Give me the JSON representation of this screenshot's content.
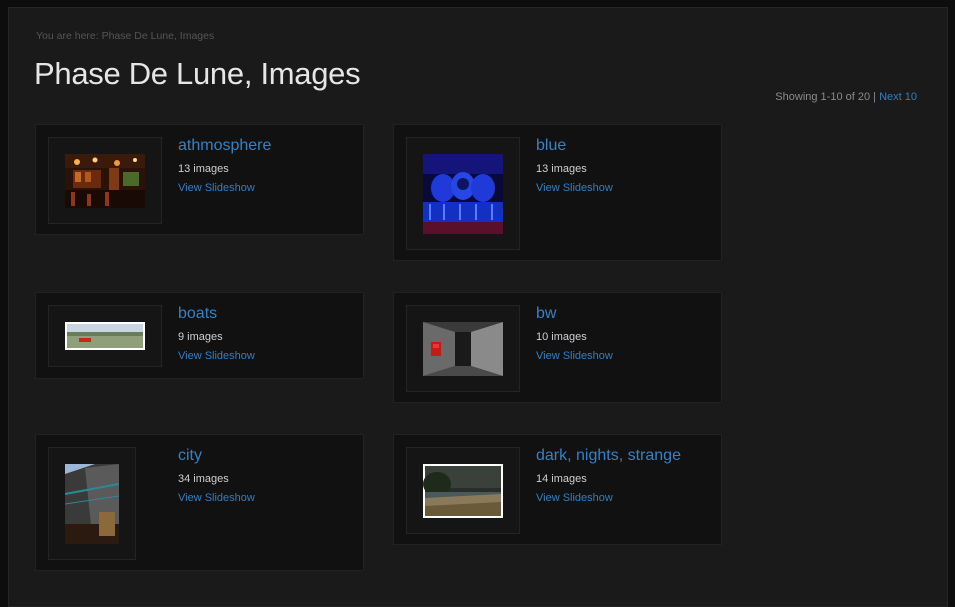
{
  "breadcrumb": "You are here: Phase De Lune, Images",
  "title": "Phase De Lune, Images",
  "pager": {
    "showing": "Showing 1-10 of 20",
    "separator": "|",
    "next": "Next 10"
  },
  "albums": [
    {
      "name": "athmosphere",
      "count": "13 images",
      "slideshow": "View Slideshow"
    },
    {
      "name": "blue",
      "count": "13 images",
      "slideshow": "View Slideshow"
    },
    {
      "name": "boats",
      "count": "9 images",
      "slideshow": "View Slideshow"
    },
    {
      "name": "bw",
      "count": "10 images",
      "slideshow": "View Slideshow"
    },
    {
      "name": "city",
      "count": "34 images",
      "slideshow": "View Slideshow"
    },
    {
      "name": "dark, nights, strange",
      "count": "14 images",
      "slideshow": "View Slideshow"
    }
  ],
  "colors": {
    "link": "#2f7fc1",
    "title": "#e6e6e6",
    "background": "#1a1a1a"
  }
}
